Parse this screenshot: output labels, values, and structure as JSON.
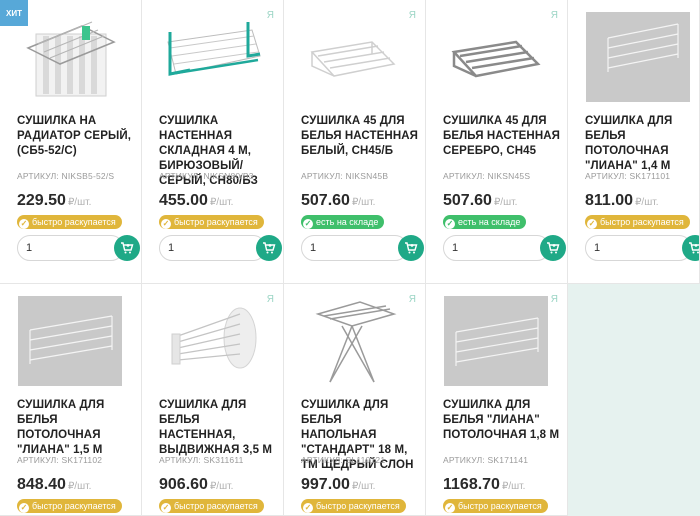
{
  "labels": {
    "hit": "хит",
    "sku_prefix": "АРТИКУЛ:",
    "unit": "₽/шт.",
    "corner_mark": "Я"
  },
  "products": [
    {
      "title": "СУШИЛКА НА РАДИАТОР СЕРЫЙ, (СБ5-52/С)",
      "sku": "АРТИКУЛ: NIKSB5-52/S",
      "price": "229.50",
      "badge": "быстро раскупается",
      "qty": "1"
    },
    {
      "title": "СУШИЛКА НАСТЕННАЯ СКЛАДНАЯ 4 М, БИРЮЗОВЫЙ/СЕРЫЙ, СН80/БЗ",
      "sku": "АРТИКУЛ: NIKSN80/B3",
      "price": "455.00",
      "badge": "быстро раскупается",
      "qty": "1"
    },
    {
      "title": "СУШИЛКА 45 ДЛЯ БЕЛЬЯ НАСТЕННАЯ БЕЛЫЙ, СН45/Б",
      "sku": "АРТИКУЛ: NIKSN45B",
      "price": "507.60",
      "badge": "есть на складе",
      "qty": "1"
    },
    {
      "title": "СУШИЛКА 45 ДЛЯ БЕЛЬЯ НАСТЕННАЯ СЕРЕБРО, СН45",
      "sku": "АРТИКУЛ: NIKSN45S",
      "price": "507.60",
      "badge": "есть на складе",
      "qty": "1"
    },
    {
      "title": "СУШИЛКА ДЛЯ БЕЛЬЯ ПОТОЛОЧНАЯ \"ЛИАНА\" 1,4 М",
      "sku": "АРТИКУЛ: SK171101",
      "price": "811.00",
      "badge": "быстро раскупается",
      "qty": "1"
    },
    {
      "title": "СУШИЛКА ДЛЯ БЕЛЬЯ ПОТОЛОЧНАЯ \"ЛИАНА\" 1,5 М",
      "sku": "АРТИКУЛ: SK171102",
      "price": "848.40",
      "badge": "быстро раскупается",
      "qty": "1"
    },
    {
      "title": "СУШИЛКА ДЛЯ БЕЛЬЯ НАСТЕННАЯ, ВЫДВИЖНАЯ 3,5 М",
      "sku": "АРТИКУЛ: SK311611",
      "price": "906.60",
      "badge": "быстро раскупается",
      "qty": "1"
    },
    {
      "title": "СУШИЛКА ДЛЯ БЕЛЬЯ НАПОЛЬНАЯ \"СТАНДАРТ\" 18 М, ТМ ЩЕДРЫЙ СЛОН",
      "sku": "АРТИКУЛ: SL110121",
      "price": "997.00",
      "badge": "быстро раскупается",
      "qty": "1"
    },
    {
      "title": "СУШИЛКА ДЛЯ БЕЛЬЯ \"ЛИАНА\" ПОТОЛОЧНАЯ 1,8 М",
      "sku": "АРТИКУЛ: SK171141",
      "price": "1168.70",
      "badge": "быстро раскупается",
      "qty": "1"
    }
  ],
  "colors": {
    "accent": "#1fa987",
    "fast_badge": "#e0b63b",
    "stock_badge": "#3fbf6b",
    "hit_badge": "#57a8d8"
  }
}
